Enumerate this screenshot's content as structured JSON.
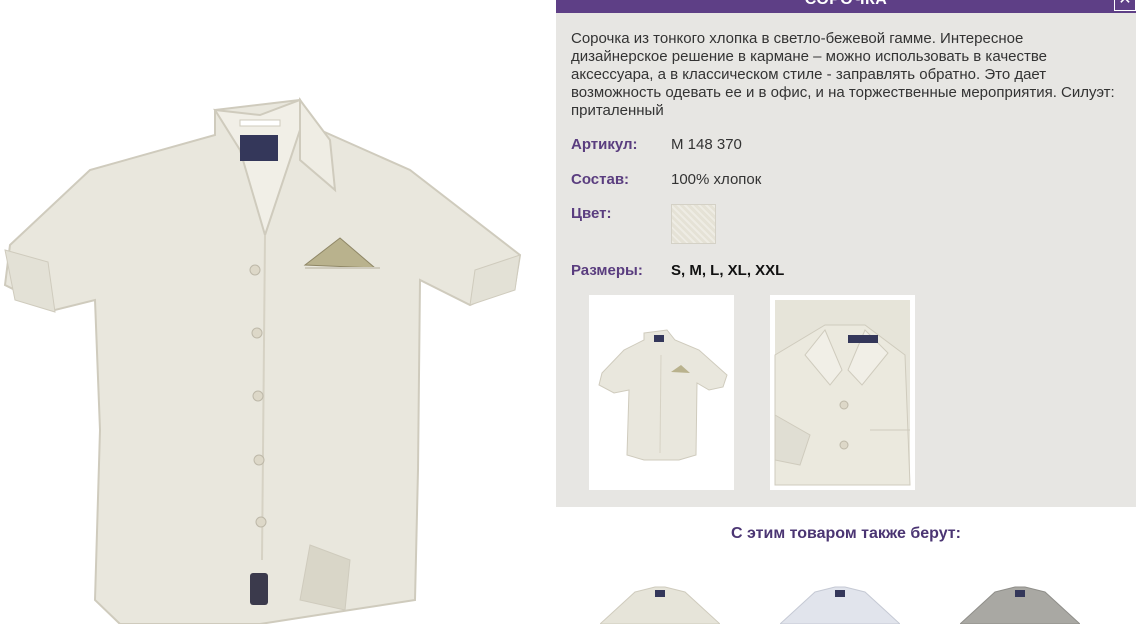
{
  "dialog": {
    "title": "СОРОЧКА",
    "close_icon": "close-icon"
  },
  "description": "Сорочка из тонкого хлопка в светло-бежевой гамме. Интересное дизайнерское решение в кармане – можно использовать в качестве аксессуара, а в классическом стиле - заправлять обратно. Это дает возможность одевать ее и в офис, и на торжественные мероприятия. Силуэт: приталенный",
  "properties": {
    "article_label": "Артикул:",
    "article_value": "M 148 370",
    "composition_label": "Состав:",
    "composition_value": "100% хлопок",
    "color_label": "Цвет:",
    "sizes_label": "Размеры:",
    "sizes_value": "S, M, L, XL, XXL"
  },
  "colors": {
    "accent": "#5e3f86",
    "label": "#5a3d7f",
    "panel_bg": "#e7e6e3",
    "swatch": "#e5e2d6"
  },
  "also_bought": {
    "title": "С этим товаром также берут:"
  }
}
